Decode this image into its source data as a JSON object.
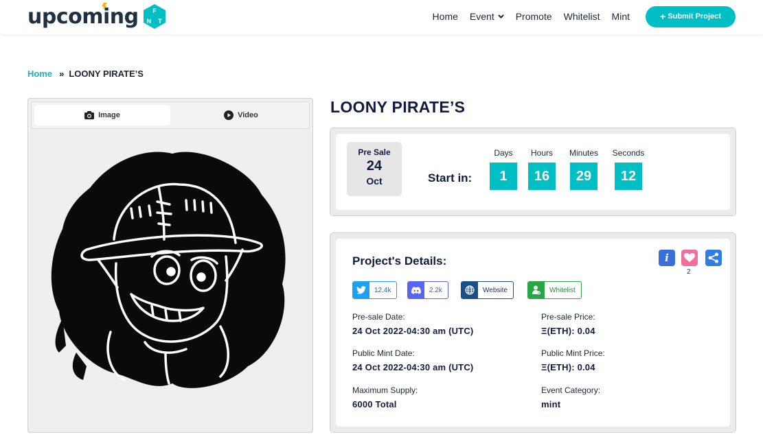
{
  "header": {
    "logo_text": "upcoming",
    "logo_badge": [
      "F",
      "N",
      "T"
    ],
    "nav": [
      {
        "label": "Home"
      },
      {
        "label": "Event",
        "has_dropdown": true
      },
      {
        "label": "Promote"
      },
      {
        "label": "Whitelist"
      },
      {
        "label": "Mint"
      }
    ],
    "submit_label": "Submit Project",
    "accent_color": "#00bfc4"
  },
  "breadcrumb": {
    "home": "Home",
    "current": "LOONY PIRATE’S"
  },
  "media": {
    "tabs": [
      {
        "label": "Image",
        "icon": "camera-icon",
        "active": true
      },
      {
        "label": "Video",
        "icon": "play-circle-icon",
        "active": false
      }
    ]
  },
  "project": {
    "title": "LOONY PIRATE’S"
  },
  "countdown": {
    "sale_type": "Pre Sale",
    "day": "24",
    "month": "Oct",
    "start_label": "Start in:",
    "units": [
      {
        "label": "Days",
        "value": "1"
      },
      {
        "label": "Hours",
        "value": "16"
      },
      {
        "label": "Minutes",
        "value": "29"
      },
      {
        "label": "Seconds",
        "value": "12"
      }
    ]
  },
  "details": {
    "title": "Project's Details:",
    "heart_count": "2",
    "chips": [
      {
        "label": "12.4k",
        "icon": "twitter-icon",
        "color": "#1da1f2"
      },
      {
        "label": "2.2k",
        "icon": "discord-icon",
        "color": "#5865f2"
      },
      {
        "label": "Website",
        "icon": "globe-icon",
        "color": "#1b4f8a"
      },
      {
        "label": "Whitelist",
        "icon": "user-check-icon",
        "color": "#27a844"
      }
    ],
    "fields": [
      {
        "label": "Pre-sale Date:",
        "value": "24 Oct 2022-04:30 am (UTC)"
      },
      {
        "label": "Pre-sale Price:",
        "value": "Ξ(ETH): 0.04"
      },
      {
        "label": "Public Mint Date:",
        "value": "24 Oct 2022-04:30 am (UTC)"
      },
      {
        "label": "Public Mint Price:",
        "value": "Ξ(ETH): 0.04"
      },
      {
        "label": "Maximum Supply:",
        "value": "6000 Total"
      },
      {
        "label": "Event Category:",
        "value": "mint"
      }
    ]
  }
}
